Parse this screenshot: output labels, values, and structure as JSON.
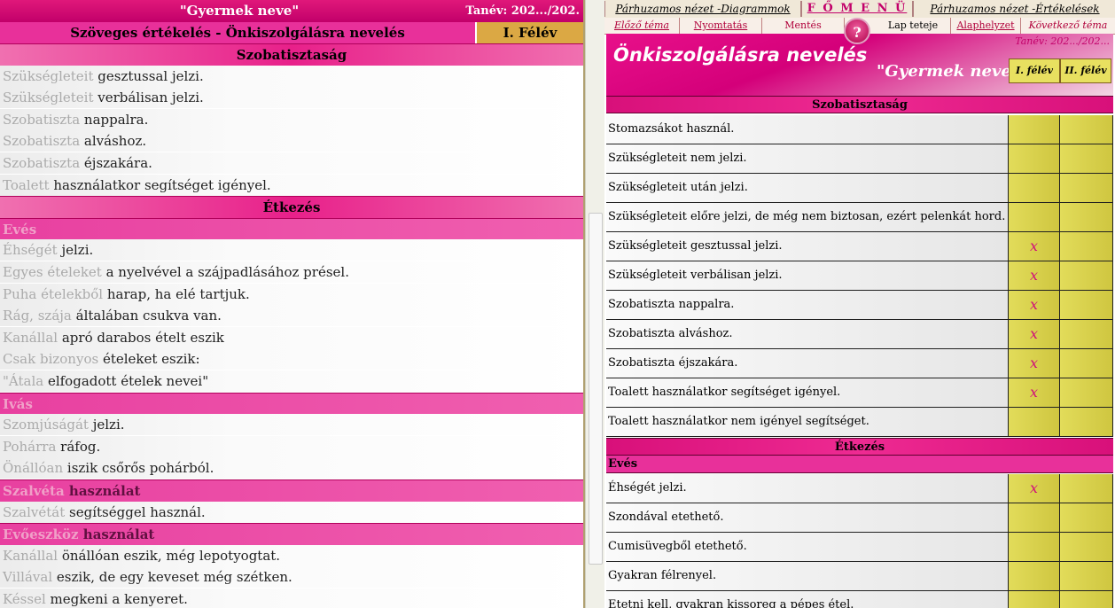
{
  "left": {
    "title": "\"Gyermek neve\"",
    "year": "Tanév: 202.../202.",
    "subtitle": "Szöveges értékelés - Önkiszolgálásra nevelés",
    "semester": "I. Félév",
    "rows": [
      {
        "type": "sec",
        "text": "Szobatisztaság"
      },
      {
        "type": "item",
        "dim": "Szükségleteit",
        "rest": " gesztussal jelzi."
      },
      {
        "type": "item",
        "dim": "Szükségleteit",
        "rest": " verbálisan jelzi."
      },
      {
        "type": "item",
        "dim": "Szobatiszta",
        "rest": " nappalra."
      },
      {
        "type": "item",
        "dim": "Szobatiszta",
        "rest": " alváshoz."
      },
      {
        "type": "item",
        "dim": "Szobatiszta",
        "rest": " éjszakára."
      },
      {
        "type": "item",
        "dim": "Toalett",
        "rest": " használatkor segítséget igényel."
      },
      {
        "type": "sec",
        "text": "Étkezés"
      },
      {
        "type": "subsec",
        "text": "Evés"
      },
      {
        "type": "item",
        "dim": "Éhségét",
        "rest": " jelzi."
      },
      {
        "type": "item",
        "dim": "Egyes ételeket",
        "rest": " a nyelvével a szájpadlásához présel."
      },
      {
        "type": "item",
        "dim": "Puha ételekből",
        "rest": " harap, ha elé tartjuk."
      },
      {
        "type": "item",
        "dim": "Rág, szája",
        "rest": " általában csukva van."
      },
      {
        "type": "item",
        "dim": "Kanállal",
        "rest": " apró darabos ételt eszik"
      },
      {
        "type": "item",
        "dim": "Csak bizonyos",
        "rest": " ételeket eszik:"
      },
      {
        "type": "item",
        "dim": "\"Átala",
        "rest": " elfogadott ételek nevei\""
      },
      {
        "type": "subsec",
        "text": "Ivás"
      },
      {
        "type": "item",
        "dim": "Szomjúságát",
        "rest": " jelzi."
      },
      {
        "type": "item",
        "dim": "Pohárra",
        "rest": " ráfog."
      },
      {
        "type": "item",
        "dim": "Önállóan",
        "rest": " iszik csőrős pohárból."
      },
      {
        "type": "subsec",
        "dimtext": "Szalvéta",
        "text": " használat"
      },
      {
        "type": "item",
        "dim": "Szalvétát",
        "rest": " segítséggel használ."
      },
      {
        "type": "subsec",
        "dimtext": "Evőeszköz",
        "text": " használat"
      },
      {
        "type": "item",
        "dim": "Kanállal",
        "rest": " önállóan eszik, még lepotyogtat."
      },
      {
        "type": "item",
        "dim": "Villával",
        "rest": " eszik, de egy keveset még szétken."
      },
      {
        "type": "item",
        "dim": "Késsel",
        "rest": " megkeni a kenyeret."
      }
    ]
  },
  "right": {
    "nav": [
      "Párhuzamos nézet -Diagrammok",
      "F Ő M E N Ü",
      "Párhuzamos nézet -Értékelések"
    ],
    "tools": [
      "Előző téma",
      "Nyomtatás",
      "Mentés",
      "Lap teteje",
      "Alaphelyzet",
      "Következő téma"
    ],
    "help_icon": "?",
    "header_title": "Önkiszolgálásra nevelés",
    "child_name": "\"Gyermek neve\"",
    "year": "Tanév: 202.../202...",
    "sem1": "I. félév",
    "sem2": "II. félév",
    "mark": "x",
    "section1": "Szobatisztaság",
    "section2": "Étkezés",
    "subsection": "Evés",
    "rows1": [
      {
        "text": "Stomazsákot használ.",
        "s1": ""
      },
      {
        "text": "Szükségleteit nem jelzi.",
        "s1": ""
      },
      {
        "text": "Szükségleteit után jelzi.",
        "s1": ""
      },
      {
        "text": "Szükségleteit előre jelzi, de még nem biztosan, ezért pelenkát hord.",
        "s1": ""
      },
      {
        "text": "Szükségleteit gesztussal jelzi.",
        "s1": "x"
      },
      {
        "text": "Szükségleteit verbálisan jelzi.",
        "s1": "x"
      },
      {
        "text": "Szobatiszta nappalra.",
        "s1": "x"
      },
      {
        "text": "Szobatiszta alváshoz.",
        "s1": "x"
      },
      {
        "text": "Szobatiszta éjszakára.",
        "s1": "x"
      },
      {
        "text": "Toalett használatkor segítséget igényel.",
        "s1": "x"
      },
      {
        "text": "Toalett használatkor nem igényel segítséget.",
        "s1": ""
      }
    ],
    "rows2": [
      {
        "text": "Éhségét jelzi.",
        "s1": "x"
      },
      {
        "text": "Szondával etethető.",
        "s1": ""
      },
      {
        "text": "Cumisüvegből etethető.",
        "s1": ""
      },
      {
        "text": "Gyakran félrenyel.",
        "s1": ""
      },
      {
        "text": "Etetni kell, gyakran kissoreg a pépes étel.",
        "s1": ""
      }
    ]
  }
}
